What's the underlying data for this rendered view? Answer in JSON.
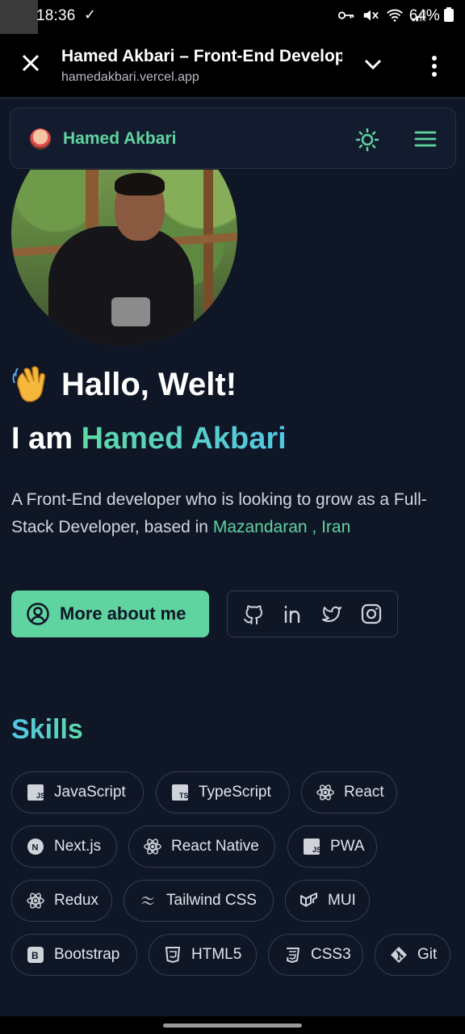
{
  "status_bar": {
    "time": "18:36",
    "battery": "64%"
  },
  "browser": {
    "title": "Hamed Akbari – Front-End Develop",
    "url": "hamedakbari.vercel.app"
  },
  "header": {
    "brand": "Hamed Akbari",
    "accent_color": "#5fd3a0"
  },
  "hero": {
    "greeting": "Hallo, Welt!",
    "intro_prefix": "I am",
    "name": "Hamed Akbari",
    "bio": "A Front-End developer who is looking to grow as a Full-Stack Developer, based in",
    "location": "Mazandaran , Iran",
    "more_button": "More about me",
    "socials": [
      "github-icon",
      "linkedin-icon",
      "twitter-icon",
      "instagram-icon"
    ]
  },
  "skills": {
    "title": "Skills",
    "items": [
      {
        "label": "JavaScript",
        "icon": "js-icon"
      },
      {
        "label": "TypeScript",
        "icon": "ts-icon"
      },
      {
        "label": "React",
        "icon": "react-icon"
      },
      {
        "label": "Next.js",
        "icon": "nextjs-icon"
      },
      {
        "label": "React Native",
        "icon": "react-icon"
      },
      {
        "label": "PWA",
        "icon": "js-icon"
      },
      {
        "label": "Redux",
        "icon": "react-icon"
      },
      {
        "label": "Tailwind CSS",
        "icon": "tailwind-icon"
      },
      {
        "label": "MUI",
        "icon": "mui-icon"
      },
      {
        "label": "Bootstrap",
        "icon": "bootstrap-icon"
      },
      {
        "label": "HTML5",
        "icon": "html5-icon"
      },
      {
        "label": "CSS3",
        "icon": "css3-icon"
      },
      {
        "label": "Git",
        "icon": "git-icon"
      }
    ]
  }
}
